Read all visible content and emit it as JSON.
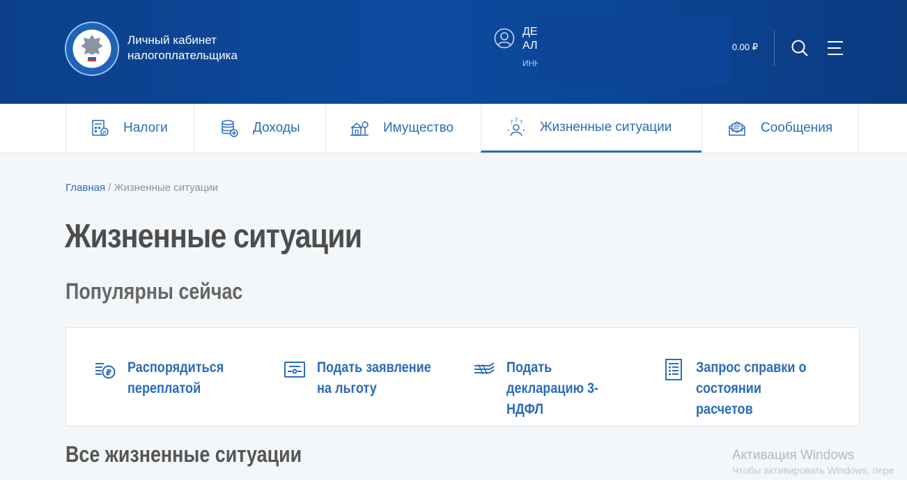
{
  "header": {
    "brand_line1": "Личный кабинет",
    "brand_line2": "налогоплательщика",
    "user_name_line1": "ДЕ",
    "user_name_line2": "АЛ",
    "user_inn": "ИНН",
    "balance": "0.00 ₽"
  },
  "nav": {
    "items": [
      {
        "label": "Налоги",
        "icon": "taxes-icon"
      },
      {
        "label": "Доходы",
        "icon": "income-icon"
      },
      {
        "label": "Имущество",
        "icon": "property-icon"
      },
      {
        "label": "Жизненные ситуации",
        "icon": "life-situations-icon"
      },
      {
        "label": "Сообщения",
        "icon": "messages-icon"
      }
    ],
    "active_index": 3
  },
  "breadcrumb": {
    "home": "Главная",
    "separator": " / ",
    "current": "Жизненные ситуации"
  },
  "page_title": "Жизненные ситуации",
  "popular": {
    "title": "Популярны сейчас",
    "items": [
      {
        "label": "Распорядиться переплатой",
        "icon": "overpayment-icon"
      },
      {
        "label": "Подать заявление на льготу",
        "icon": "benefit-application-icon"
      },
      {
        "label": "Подать декларацию 3-НДФЛ",
        "icon": "declaration-icon"
      },
      {
        "label": "Запрос справки о состоянии расчетов",
        "icon": "certificate-request-icon"
      }
    ]
  },
  "all_situations_title": "Все жизненные ситуации",
  "watermark": {
    "line1": "Активация Windows",
    "line2": "Чтобы активировать Windows, пере"
  },
  "colors": {
    "header_bg": "#0d4a9e",
    "accent": "#2b6cb8",
    "page_bg": "#f3f7fa"
  }
}
